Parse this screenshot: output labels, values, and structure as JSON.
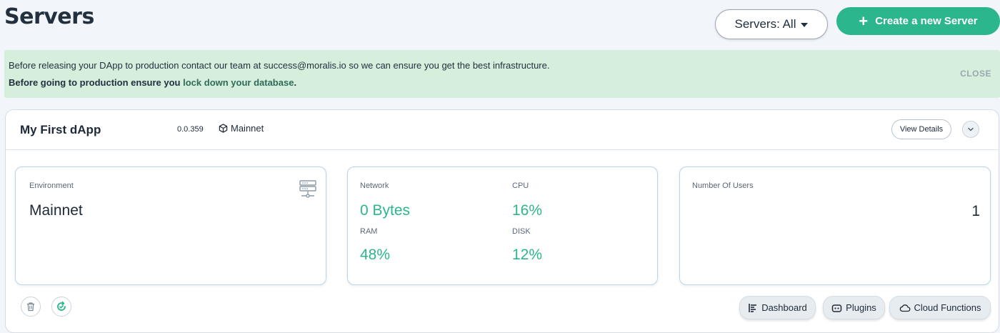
{
  "header": {
    "title": "Servers",
    "filter_label": "Servers: All",
    "create_label": "Create a new Server",
    "accent_color": "#2bb68d"
  },
  "banner": {
    "line1": "Before releasing your DApp to production contact our team at success@moralis.io so we can ensure you get the best infrastructure.",
    "line2_prefix": "Before going to production ensure you ",
    "line2_link": "lock down your database",
    "line2_suffix": ".",
    "close_label": "CLOSE",
    "background": "#d6eedc"
  },
  "server": {
    "name": "My First dApp",
    "version": "0.0.359",
    "network": "Mainnet",
    "view_details_label": "View Details",
    "environment": {
      "label": "Environment",
      "value": "Mainnet",
      "icon": "server-rack-icon"
    },
    "stats": {
      "network": {
        "label": "Network",
        "value": "0 Bytes"
      },
      "cpu": {
        "label": "CPU",
        "value": "16%"
      },
      "ram": {
        "label": "RAM",
        "value": "48%"
      },
      "disk": {
        "label": "DISK",
        "value": "12%"
      }
    },
    "users": {
      "label": "Number Of Users",
      "value": "1"
    },
    "actions": {
      "dashboard": "Dashboard",
      "plugins": "Plugins",
      "cloud_functions": "Cloud Functions"
    }
  }
}
